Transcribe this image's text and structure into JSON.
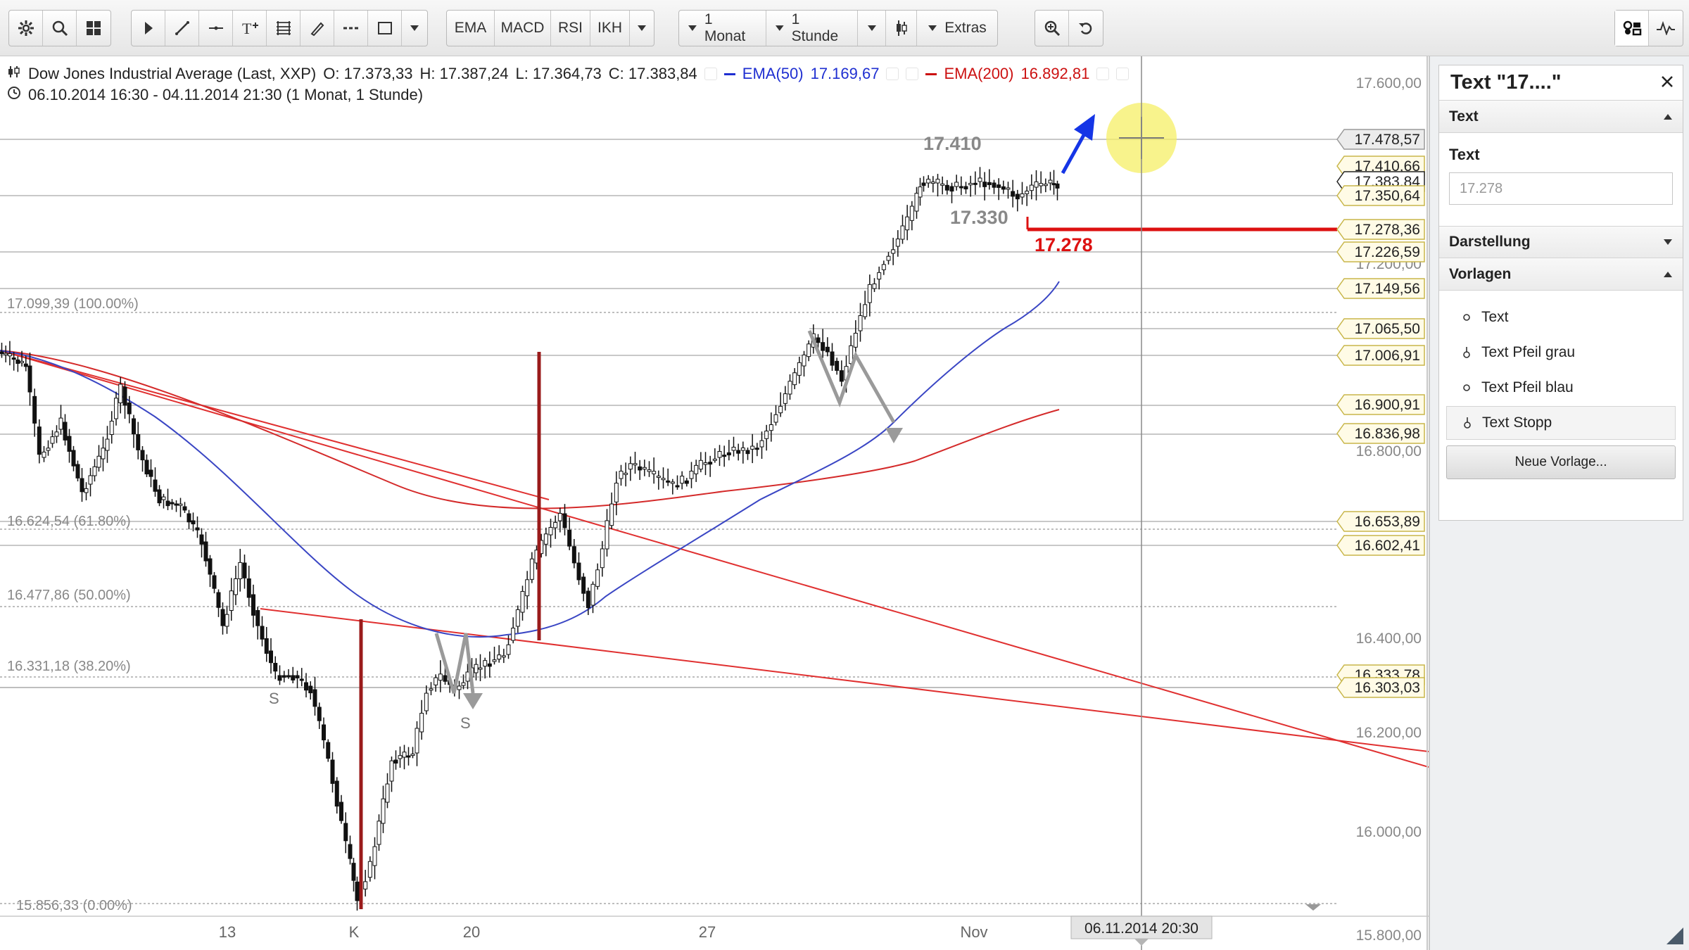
{
  "toolbar": {
    "groups": [
      {
        "icons": [
          "settings-icon",
          "search-icon",
          "layout-grid-icon"
        ]
      },
      {
        "icons": [
          "cursor-icon",
          "trendline-icon",
          "horizontal-line-icon",
          "text-tool-icon",
          "fibonacci-icon",
          "brush-icon",
          "dashed-line-icon",
          "rectangle-icon",
          "chevron-down-icon"
        ]
      }
    ],
    "indicators": [
      "EMA",
      "MACD",
      "RSI",
      "IKH"
    ],
    "period_label": "1 Monat",
    "interval_label": "1 Stunde",
    "extras_label": "Extras"
  },
  "chart": {
    "instrument": "Dow Jones Industrial Average (Last, XXP)",
    "ohlc": {
      "open": "O: 17.373,33",
      "high": "H: 17.387,24",
      "low": "L: 17.364,73",
      "close": "C: 17.383,84"
    },
    "ema50": {
      "label": "EMA(50)",
      "value": "17.169,67",
      "color": "#1f2fd1"
    },
    "ema200": {
      "label": "EMA(200)",
      "value": "16.892,81",
      "color": "#cc1111"
    },
    "range_text": "06.10.2014 16:30 - 04.11.2014 21:30 (1 Monat, 1 Stunde)",
    "cursor_date": "06.11.2014 20:30",
    "x_axis": [
      "13",
      "K",
      "20",
      "27",
      "Nov"
    ]
  },
  "chart_data": {
    "type": "candlestick",
    "y_axis_ticks": [
      "17.600,00",
      "17.200,00",
      "16.800,00",
      "16.400,00",
      "16.200,00",
      "16.000,00",
      "15.800,00"
    ],
    "price_tags": [
      {
        "label": "17.478,57",
        "style": "cursor"
      },
      {
        "label": "17.410,66",
        "style": "level"
      },
      {
        "label": "17.383,84",
        "style": "last"
      },
      {
        "label": "17.350,64",
        "style": "level"
      },
      {
        "label": "17.278,36",
        "style": "level"
      },
      {
        "label": "17.226,59",
        "style": "level"
      },
      {
        "label": "17.149,56",
        "style": "level"
      },
      {
        "label": "17.065,50",
        "style": "level"
      },
      {
        "label": "17.006,91",
        "style": "level"
      },
      {
        "label": "16.900,91",
        "style": "level"
      },
      {
        "label": "16.836,98",
        "style": "level"
      },
      {
        "label": "16.653,89",
        "style": "level"
      },
      {
        "label": "16.602,41",
        "style": "level"
      },
      {
        "label": "16.333,78",
        "style": "level"
      },
      {
        "label": "16.303,03",
        "style": "level"
      }
    ],
    "fibonacci": [
      {
        "label": "17.099,39 (100.00%)"
      },
      {
        "label": "16.624,54 (61.80%)"
      },
      {
        "label": "16.477,86 (50.00%)"
      },
      {
        "label": "16.331,18 (38.20%)"
      },
      {
        "label": "15.856,33 (0.00%)"
      }
    ],
    "annotations": [
      {
        "text": "17.410",
        "color": "#888888"
      },
      {
        "text": "17.330",
        "color": "#888888"
      },
      {
        "text": "17.278",
        "color": "#dd1111"
      },
      {
        "text": "S",
        "color": "#777777"
      },
      {
        "text": "S",
        "color": "#777777"
      }
    ]
  },
  "panel": {
    "title": "Text \"17....\"",
    "section_text": "Text",
    "field_label": "Text",
    "field_value": "17.278",
    "section_display": "Darstellung",
    "section_templates": "Vorlagen",
    "templates": [
      "Text",
      "Text Pfeil grau",
      "Text Pfeil blau",
      "Text Stopp"
    ],
    "new_template_button": "Neue Vorlage..."
  }
}
